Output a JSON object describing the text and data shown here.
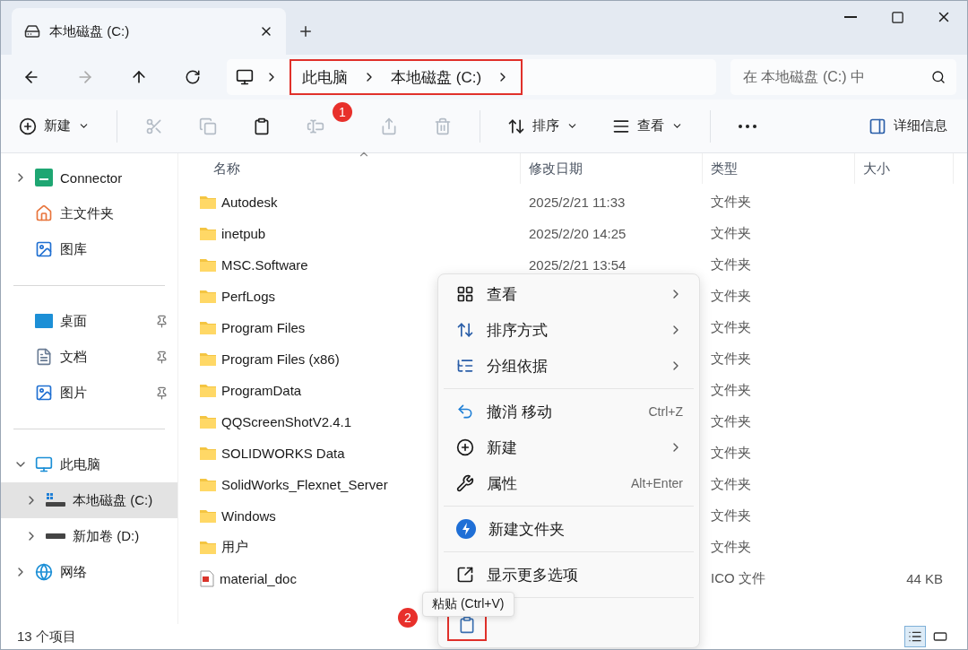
{
  "window": {
    "tab_title": "本地磁盘 (C:)"
  },
  "address": {
    "crumbs": [
      "此电脑",
      "本地磁盘 (C:)"
    ],
    "highlighted": true
  },
  "search": {
    "placeholder": "在 本地磁盘 (C:) 中"
  },
  "toolbar": {
    "items": [
      {
        "kind": "new",
        "label": "新建",
        "disabled": false
      },
      {
        "kind": "separator"
      },
      {
        "kind": "cut",
        "disabled": true
      },
      {
        "kind": "copy",
        "disabled": true
      },
      {
        "kind": "paste",
        "disabled": false
      },
      {
        "kind": "rename",
        "disabled": true
      },
      {
        "kind": "share",
        "disabled": true
      },
      {
        "kind": "delete",
        "disabled": true
      },
      {
        "kind": "separator"
      },
      {
        "kind": "sort",
        "label": "排序",
        "disabled": false
      },
      {
        "kind": "view",
        "label": "查看",
        "disabled": false
      },
      {
        "kind": "separator"
      },
      {
        "kind": "more",
        "disabled": false
      }
    ],
    "details": "详细信息"
  },
  "badges": [
    {
      "label": "1"
    },
    {
      "label": "2"
    }
  ],
  "sidebar": {
    "groups": [
      [
        {
          "label": "Connector",
          "kind": "app",
          "expanded": false,
          "selected": false
        },
        {
          "label": "主文件夹",
          "kind": "home",
          "selected": false
        },
        {
          "label": "图库",
          "kind": "gallery",
          "selected": false
        }
      ],
      [
        {
          "label": "桌面",
          "kind": "desktop",
          "pinned": true,
          "selected": false
        },
        {
          "label": "文档",
          "kind": "documents",
          "pinned": true,
          "selected": false
        },
        {
          "label": "图片",
          "kind": "pictures",
          "pinned": true,
          "selected": false
        }
      ],
      [
        {
          "label": "此电脑",
          "kind": "computer",
          "expanded": true,
          "selected": false,
          "children": [
            {
              "label": "本地磁盘 (C:)",
              "kind": "system",
              "expanded": false,
              "selected": true
            },
            {
              "label": "新加卷 (D:)",
              "kind": "drive",
              "expanded": false,
              "selected": false
            }
          ]
        },
        {
          "label": "网络",
          "kind": "network",
          "expanded": false,
          "selected": false
        }
      ]
    ]
  },
  "table": {
    "columns": [
      "名称",
      "修改日期",
      "类型",
      "大小"
    ],
    "rows": [
      {
        "name": "Autodesk",
        "kind": "folder",
        "modified": "2025/2/21 11:33",
        "type": "文件夹"
      },
      {
        "name": "inetpub",
        "kind": "folder",
        "modified": "2025/2/20 14:25",
        "type": "文件夹"
      },
      {
        "name": "MSC.Software",
        "kind": "folder",
        "modified": "2025/2/21 13:54",
        "type": "文件夹"
      },
      {
        "name": "PerfLogs",
        "kind": "folder",
        "type": "文件夹"
      },
      {
        "name": "Program Files",
        "kind": "folder",
        "type": "文件夹"
      },
      {
        "name": "Program Files (x86)",
        "kind": "folder",
        "type": "文件夹"
      },
      {
        "name": "ProgramData",
        "kind": "folder",
        "type": "文件夹"
      },
      {
        "name": "QQScreenShotV2.4.1",
        "kind": "folder",
        "type": "文件夹"
      },
      {
        "name": "SOLIDWORKS Data",
        "kind": "folder",
        "type": "文件夹"
      },
      {
        "name": "SolidWorks_Flexnet_Server",
        "kind": "folder",
        "type": "文件夹"
      },
      {
        "name": "Windows",
        "kind": "folder",
        "type": "文件夹"
      },
      {
        "name": "用户",
        "kind": "folder",
        "type": "文件夹"
      },
      {
        "name": "material_doc",
        "kind": "file",
        "type": "ICO 文件",
        "size": "44 KB"
      }
    ]
  },
  "context_menu": {
    "groups": [
      [
        {
          "kind": "view",
          "label": "查看",
          "submenu": true
        },
        {
          "kind": "sort",
          "label": "排序方式",
          "submenu": true
        },
        {
          "kind": "group",
          "label": "分组依据",
          "submenu": true
        }
      ],
      [
        {
          "kind": "undo",
          "label": "撤消 移动",
          "shortcut": "Ctrl+Z"
        },
        {
          "kind": "new",
          "label": "新建",
          "submenu": true
        },
        {
          "kind": "properties",
          "label": "属性",
          "shortcut": "Alt+Enter"
        }
      ],
      [
        {
          "kind": "folder",
          "label": "新建文件夹"
        }
      ],
      [
        {
          "kind": "more",
          "label": "显示更多选项"
        }
      ]
    ],
    "paste": {
      "tooltip": "粘贴 (Ctrl+V)",
      "highlighted": true
    }
  },
  "status_bar": {
    "count": "13 个项目",
    "views": [
      {
        "kind": "details",
        "selected": true
      },
      {
        "kind": "tiles",
        "selected": false
      }
    ]
  }
}
